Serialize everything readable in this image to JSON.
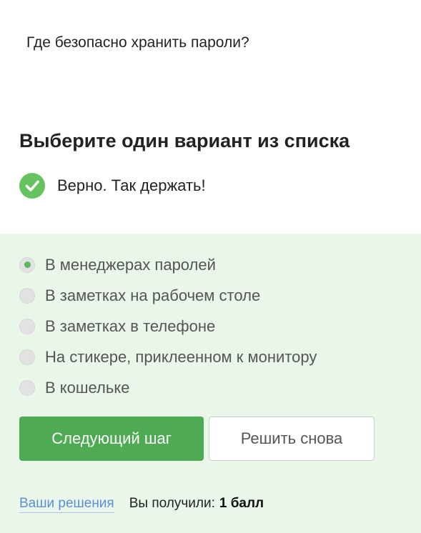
{
  "question": {
    "text": "Где безопасно хранить пароли?"
  },
  "instruction": "Выберите один вариант из списка",
  "feedback": {
    "text": "Верно. Так держать!",
    "icon": "check-circle-icon",
    "color": "#66c25f"
  },
  "options": [
    {
      "label": "В менеджерах паролей",
      "selected": true
    },
    {
      "label": "В заметках на рабочем столе",
      "selected": false
    },
    {
      "label": "В заметках в телефоне",
      "selected": false
    },
    {
      "label": "На стикере, приклеенном к монитору",
      "selected": false
    },
    {
      "label": "В кошельке",
      "selected": false
    }
  ],
  "buttons": {
    "next_label": "Следующий шаг",
    "retry_label": "Решить снова"
  },
  "footer": {
    "solutions_link": "Ваши решения",
    "score_label": "Вы получили:",
    "score_value": "1 балл"
  },
  "colors": {
    "accent": "#4fab53",
    "panel_background": "#e9f6e9",
    "link": "#5c8fd6"
  }
}
